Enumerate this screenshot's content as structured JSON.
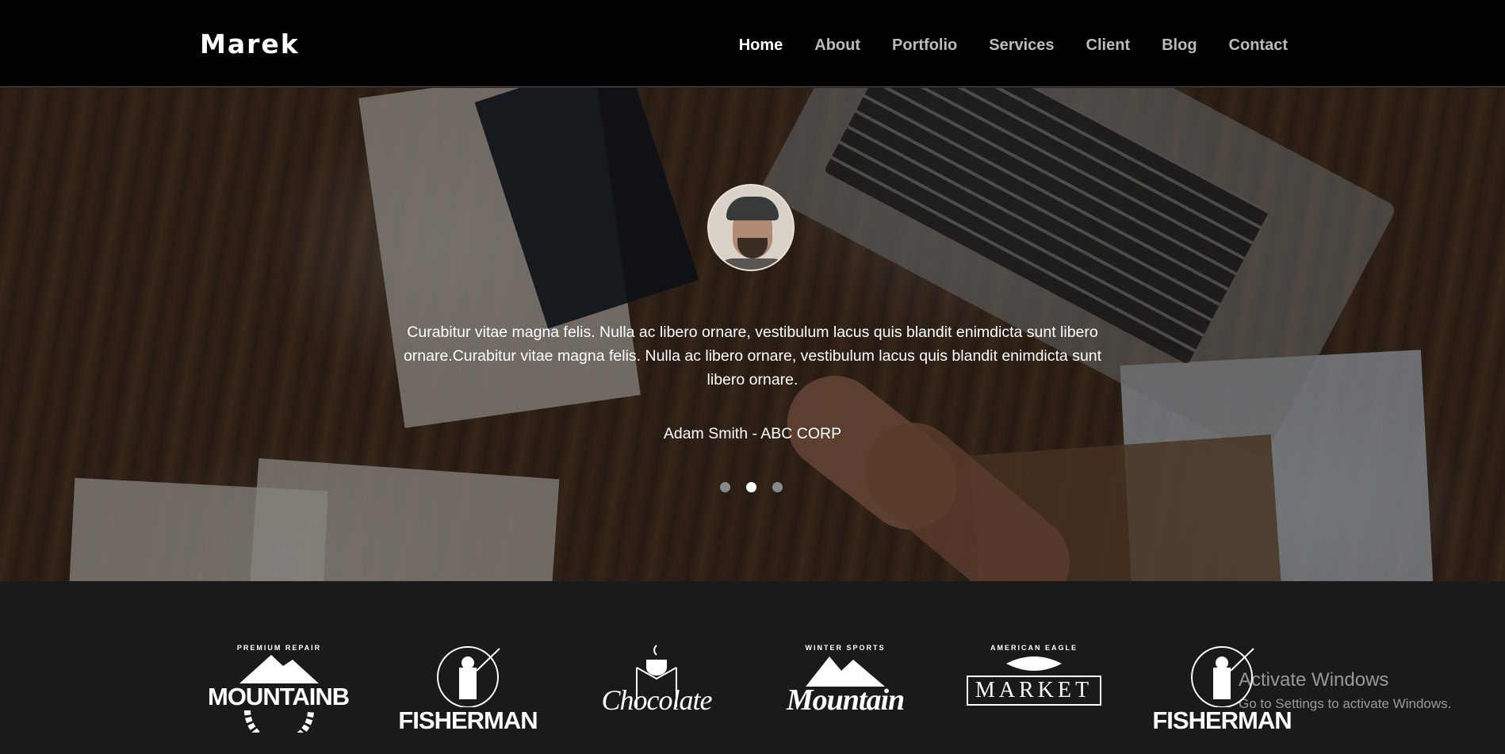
{
  "header": {
    "logo": "Marek",
    "nav": [
      {
        "label": "Home",
        "active": true
      },
      {
        "label": "About"
      },
      {
        "label": "Portfolio"
      },
      {
        "label": "Services"
      },
      {
        "label": "Client"
      },
      {
        "label": "Blog"
      },
      {
        "label": "Contact"
      }
    ]
  },
  "testimonial": {
    "quote": "Curabitur vitae magna felis. Nulla ac libero ornare, vestibulum lacus quis blandit enimdicta sunt libero ornare.Curabitur vitae magna felis. Nulla ac libero ornare, vestibulum lacus quis blandit enimdicta sunt libero ornare.",
    "author": "Adam Smith - ABC CORP",
    "slide_count": 3,
    "active_slide": 2
  },
  "clients": [
    {
      "top": "PREMIUM REPAIR",
      "name": "MOUNTAINBIKE",
      "icon": "mountain-gear-icon"
    },
    {
      "top": "",
      "name": "FISHERMAN",
      "icon": "fisherman-icon"
    },
    {
      "top": "",
      "name": "Chocolate",
      "icon": "coffee-cup-icon"
    },
    {
      "top": "WINTER SPORTS",
      "name": "Mountain",
      "icon": "mountain-peaks-icon"
    },
    {
      "top": "AMERICAN EAGLE",
      "name": "MARKET",
      "icon": "fish-icon"
    },
    {
      "top": "",
      "name": "FISHERMAN",
      "icon": "fisherman-icon"
    }
  ],
  "watermark": {
    "line1": "Activate Windows",
    "line2": "Go to Settings to activate Windows."
  },
  "colors": {
    "header_bg": "#000000",
    "strip_bg": "#1a1a1a",
    "nav_inactive": "#bbbbbb",
    "nav_active": "#ffffff"
  }
}
